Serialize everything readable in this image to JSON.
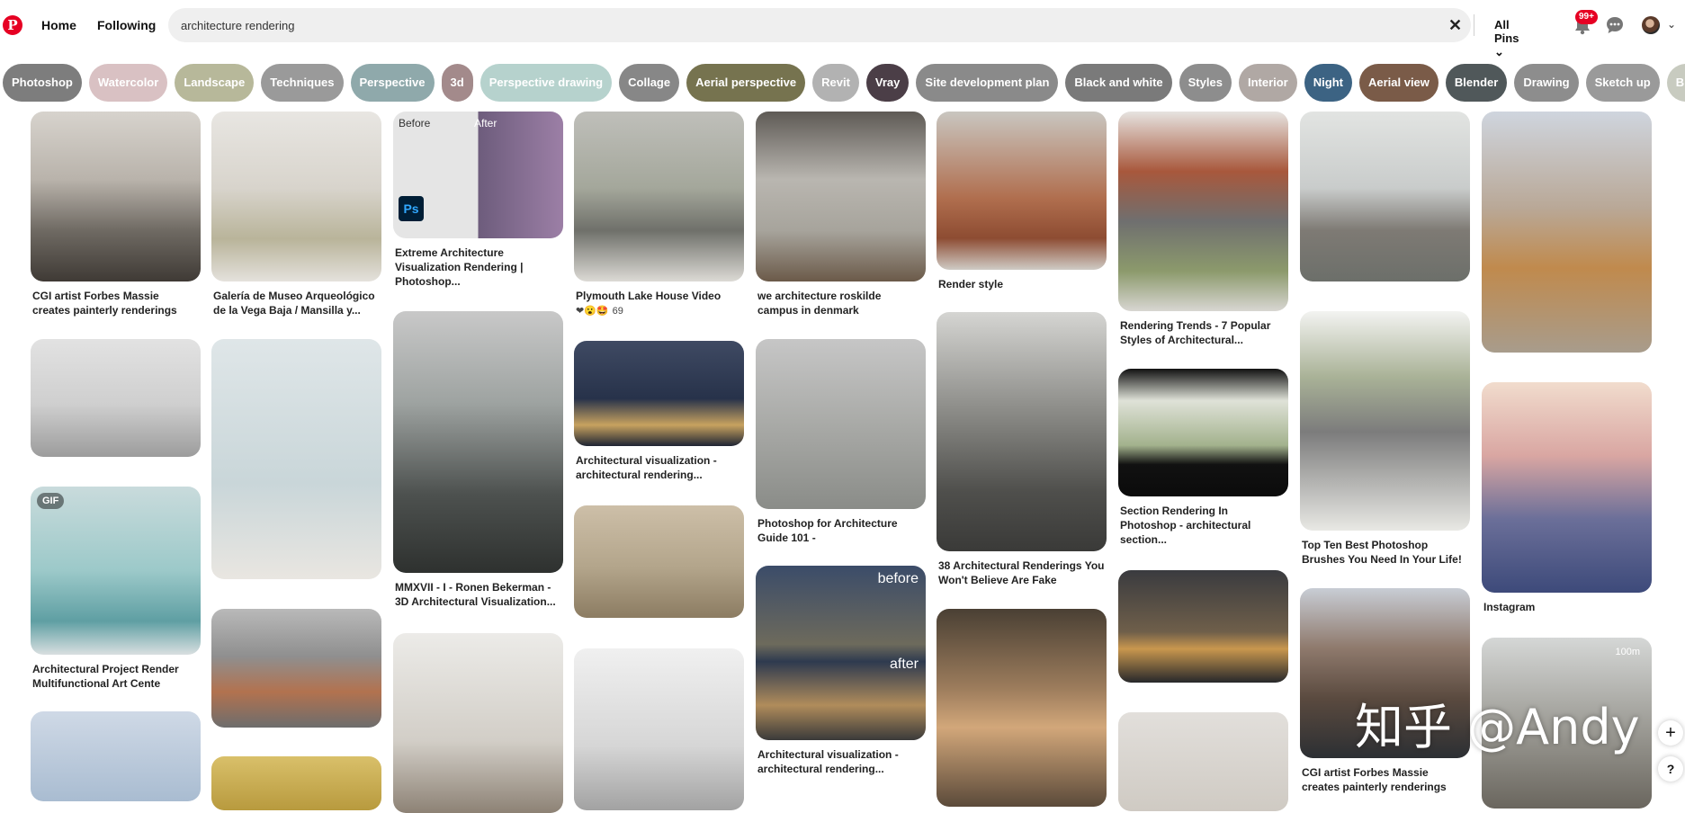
{
  "header": {
    "logo_letter": "P",
    "nav": {
      "home": "Home",
      "following": "Following"
    },
    "search": {
      "value": "architecture rendering"
    },
    "clear_symbol": "✕",
    "scope": "All Pins ⌄",
    "notifications_badge": "99+",
    "account_chevron": "⌄"
  },
  "chips": [
    {
      "label": "Photoshop",
      "color": "#7d7d7d"
    },
    {
      "label": "Watercolor",
      "color": "#d9c1c3"
    },
    {
      "label": "Landscape",
      "color": "#b7b89a"
    },
    {
      "label": "Techniques",
      "color": "#9a9a9a"
    },
    {
      "label": "Perspective",
      "color": "#8fa9ab"
    },
    {
      "label": "3d",
      "color": "#a38a8b"
    },
    {
      "label": "Perspective drawing",
      "color": "#b6d2cd"
    },
    {
      "label": "Collage",
      "color": "#878787"
    },
    {
      "label": "Aerial perspective",
      "color": "#76734f"
    },
    {
      "label": "Revit",
      "color": "#b2b2b2"
    },
    {
      "label": "Vray",
      "color": "#4b3e47"
    },
    {
      "label": "Site development plan",
      "color": "#8a8a8a"
    },
    {
      "label": "Black and white",
      "color": "#7a7a7a"
    },
    {
      "label": "Styles",
      "color": "#8d8d8d"
    },
    {
      "label": "Interior",
      "color": "#b0a8a4"
    },
    {
      "label": "Night",
      "color": "#3c6383"
    },
    {
      "label": "Aerial view",
      "color": "#7a5b48"
    },
    {
      "label": "Blender",
      "color": "#50585a"
    },
    {
      "label": "Drawing",
      "color": "#8d8d8d"
    },
    {
      "label": "Sketch up",
      "color": "#9a9a9a"
    },
    {
      "label": "Bird eye",
      "color": "#c8cbc0"
    }
  ],
  "pins": {
    "col0": [
      {
        "title": "CGI artist Forbes Massie creates painterly renderings"
      },
      {
        "title": ""
      },
      {
        "title": "Architectural Project Render Multifunctional Art Cente",
        "tag": "GIF"
      },
      {
        "title": ""
      }
    ],
    "col1": [
      {
        "title": "Galería de Museo Arqueológico de la Vega Baja / Mansilla y..."
      },
      {
        "title": ""
      },
      {
        "title": ""
      },
      {
        "title": ""
      }
    ],
    "col2": [
      {
        "title": "Extreme Architecture Visualization Rendering | Photoshop...",
        "overlay_before": "Before",
        "overlay_after": "After",
        "overlay_ps": "Ps"
      },
      {
        "title": "MMXVII - I - Ronen Bekerman - 3D Architectural Visualization..."
      },
      {
        "title": ""
      }
    ],
    "col3": [
      {
        "title": "Plymouth Lake House Video",
        "reactions": "❤😮🤩",
        "reaction_count": "69"
      },
      {
        "title": "Architectural visualization - architectural rendering..."
      },
      {
        "title": ""
      },
      {
        "title": ""
      }
    ],
    "col4": [
      {
        "title": "we architecture roskilde campus in denmark"
      },
      {
        "title": "Photoshop for Architecture Guide 101 -"
      },
      {
        "title": "Architectural visualization - architectural rendering...",
        "overlay_before": "before",
        "overlay_after": "after"
      }
    ],
    "col5": [
      {
        "title": "Render style"
      },
      {
        "title": "38 Architectural Renderings You Won't Believe Are Fake"
      },
      {
        "title": ""
      }
    ],
    "col6": [
      {
        "title": "Rendering Trends - 7 Popular Styles of Architectural..."
      },
      {
        "title": "Section Rendering In Photoshop - architectural section..."
      },
      {
        "title": ""
      },
      {
        "title": ""
      }
    ],
    "col7": [
      {
        "title": ""
      },
      {
        "title": "Top Ten Best Photoshop Brushes You Need In Your Life!"
      },
      {
        "title": "CGI artist Forbes Massie creates painterly renderings"
      }
    ],
    "col8": [
      {
        "title": ""
      },
      {
        "title": "Instagram"
      },
      {
        "title": "",
        "tag": "100m"
      }
    ]
  },
  "watermark": "知乎 @Andy",
  "floating": {
    "plus": "+",
    "help": "?"
  },
  "colors": {
    "brand": "#e60023",
    "search_bg": "#efefef"
  }
}
